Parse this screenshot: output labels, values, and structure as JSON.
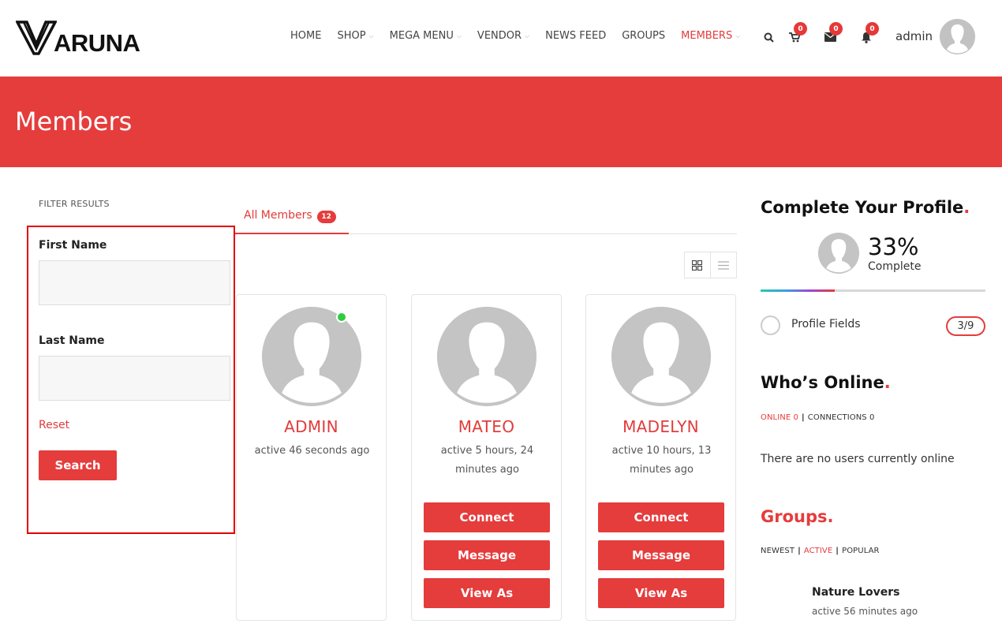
{
  "header": {
    "logo_text": "ARUNA",
    "nav": [
      {
        "label": "HOME",
        "dropdown": false,
        "active": false
      },
      {
        "label": "SHOP",
        "dropdown": true,
        "active": false
      },
      {
        "label": "MEGA MENU",
        "dropdown": true,
        "active": false
      },
      {
        "label": "VENDOR",
        "dropdown": true,
        "active": false
      },
      {
        "label": "NEWS FEED",
        "dropdown": false,
        "active": false
      },
      {
        "label": "GROUPS",
        "dropdown": false,
        "active": false
      },
      {
        "label": "MEMBERS",
        "dropdown": true,
        "active": true
      }
    ],
    "icons": {
      "search": "search-icon",
      "cart": "cart-icon",
      "messages": "envelope-icon",
      "notifications": "bell-icon"
    },
    "cart_count": "0",
    "messages_count": "0",
    "notifications_count": "0",
    "user_name": "admin"
  },
  "banner": {
    "title": "Members",
    "color": "#e53c3c"
  },
  "filter": {
    "title": "FILTER RESULTS",
    "first_name_label": "First Name",
    "first_name_value": "",
    "last_name_label": "Last Name",
    "last_name_value": "",
    "reset_label": "Reset",
    "search_label": "Search"
  },
  "tabs": {
    "all_members_label": "All Members",
    "all_members_count": "12"
  },
  "members": [
    {
      "name": "ADMIN",
      "activity": "active 46 seconds ago",
      "online": true,
      "buttons": []
    },
    {
      "name": "MATEO",
      "activity": "active 5 hours, 24 minutes ago",
      "online": false,
      "buttons": [
        "Connect",
        "Message",
        "View As"
      ]
    },
    {
      "name": "MADELYN",
      "activity": "active 10 hours, 13 minutes ago",
      "online": false,
      "buttons": [
        "Connect",
        "Message",
        "View As"
      ]
    }
  ],
  "sidebar": {
    "profile": {
      "title": "Complete Your Profile",
      "percent": "33%",
      "percent_value": 0.33,
      "complete_label": "Complete",
      "field_label": "Profile Fields",
      "field_count": "3/9"
    },
    "online": {
      "title": "Who’s Online",
      "online_link": "ONLINE 0",
      "connections_link": "CONNECTIONS 0",
      "empty_text": "There are no users currently online"
    },
    "groups": {
      "title": "Groups",
      "newest": "NEWEST",
      "active": "ACTIVE",
      "popular": "POPULAR",
      "items": [
        {
          "name": "Nature Lovers",
          "activity": "active 56 minutes ago"
        }
      ]
    }
  },
  "colors": {
    "accent": "#e53c3c",
    "online": "#2ecc40"
  }
}
